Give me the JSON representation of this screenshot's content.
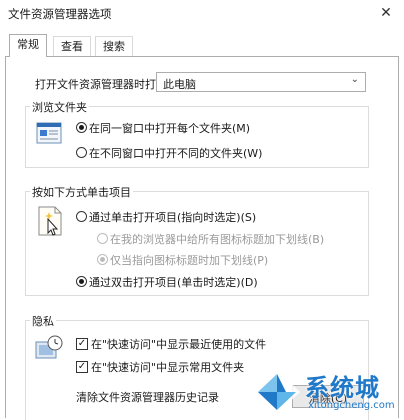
{
  "window": {
    "title": "文件资源管理器选项",
    "close_glyph": "✕"
  },
  "tabs": [
    {
      "label": "常规",
      "active": true
    },
    {
      "label": "查看",
      "active": false
    },
    {
      "label": "搜索",
      "active": false
    }
  ],
  "open_with": {
    "label": "打开文件资源管理器时打开:",
    "value": "此电脑"
  },
  "browse_folders": {
    "legend": "浏览文件夹",
    "options": [
      {
        "label": "在同一窗口中打开每个文件夹(M)",
        "selected": true
      },
      {
        "label": "在不同窗口中打开不同的文件夹(W)",
        "selected": false
      }
    ]
  },
  "click_items": {
    "legend": "按如下方式单击项目",
    "options": [
      {
        "label": "通过单击打开项目(指向时选定)(S)",
        "selected": false
      },
      {
        "label": "在我的浏览器中给所有图标标题加下划线(B)",
        "selected": false,
        "disabled": true
      },
      {
        "label": "仅当指向图标标题时加下划线(P)",
        "selected": true,
        "disabled": true
      },
      {
        "label": "通过双击打开项目(单击时选定)(D)",
        "selected": true
      }
    ]
  },
  "privacy": {
    "legend": "隐私",
    "checks": [
      {
        "label": "在\"快速访问\"中显示最近使用的文件",
        "checked": true
      },
      {
        "label": "在\"快速访问\"中显示常用文件夹",
        "checked": true
      }
    ],
    "clear_label": "清除文件资源管理器历史记录",
    "clear_button": "清除(C)"
  },
  "watermark": {
    "brand": "系统城",
    "url": "xitongcheng.com",
    "color": "#1f78c8"
  }
}
